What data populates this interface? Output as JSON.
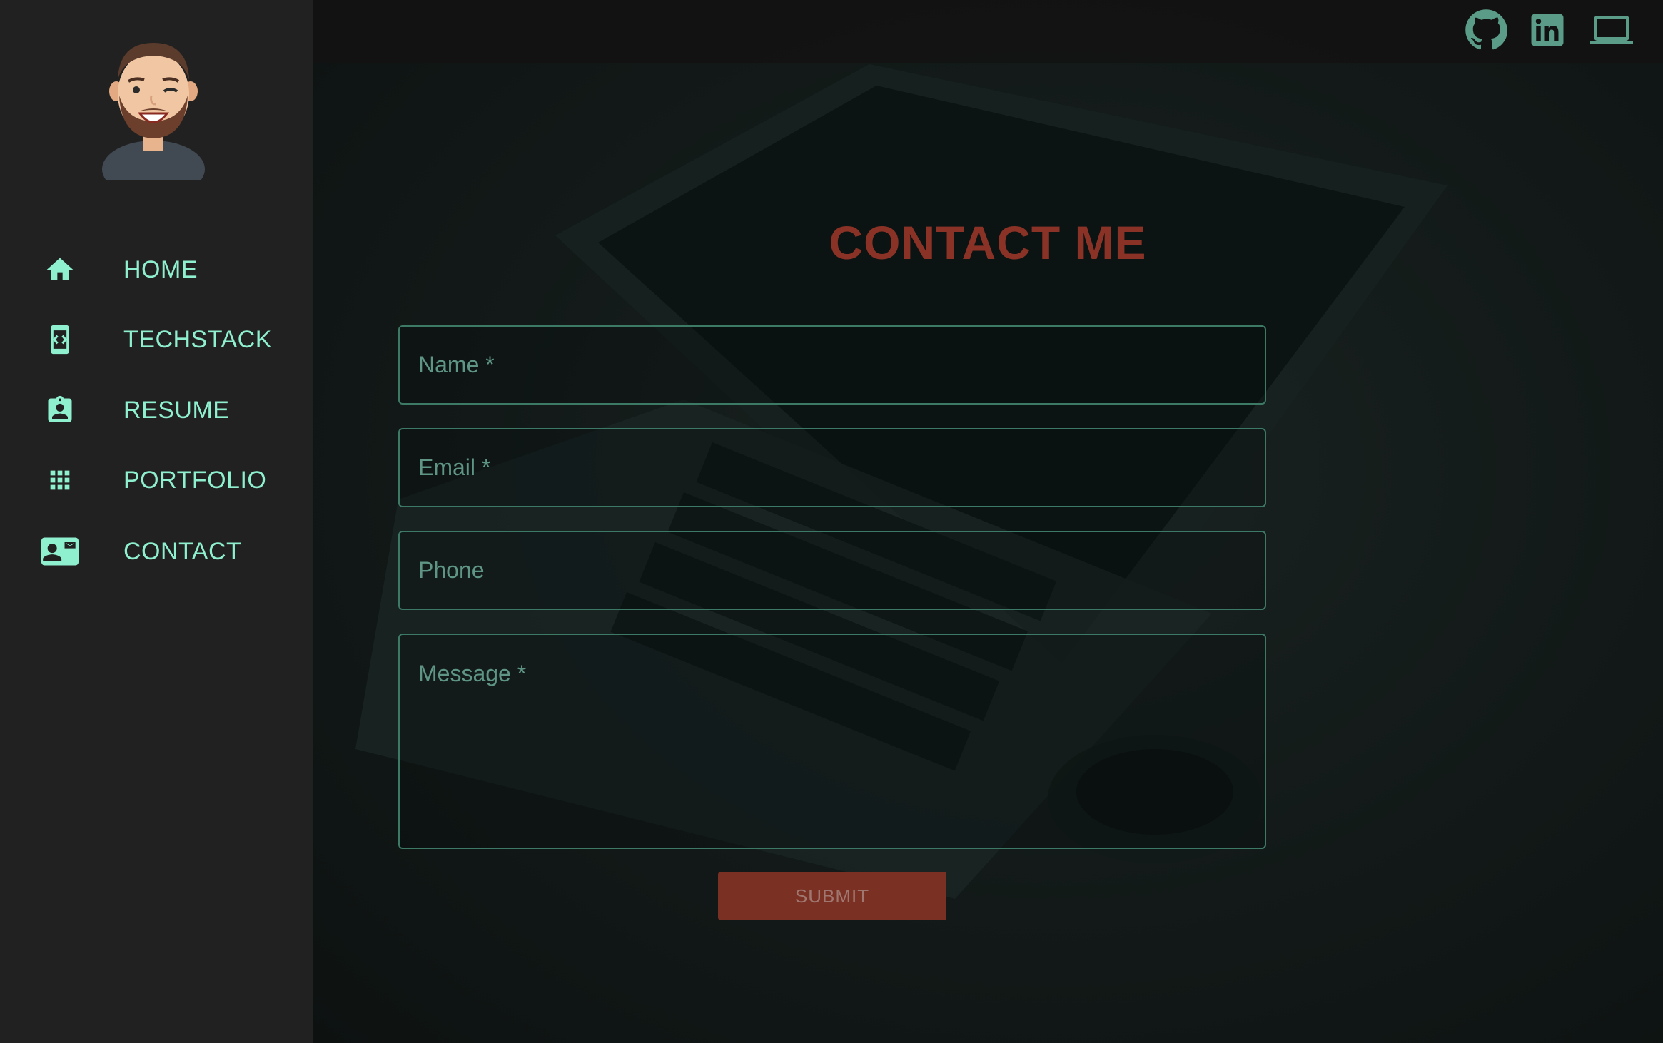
{
  "sidebar": {
    "items": [
      {
        "label": "HOME",
        "icon": "home-icon"
      },
      {
        "label": "TECHSTACK",
        "icon": "code-phone-icon"
      },
      {
        "label": "RESUME",
        "icon": "badge-icon"
      },
      {
        "label": "PORTFOLIO",
        "icon": "grid-icon"
      },
      {
        "label": "CONTACT",
        "icon": "contact-card-icon"
      }
    ]
  },
  "topbar": {
    "icons": [
      "github-icon",
      "linkedin-icon",
      "laptop-icon"
    ]
  },
  "contact": {
    "title": "CONTACT ME",
    "name_placeholder": "Name *",
    "email_placeholder": "Email *",
    "phone_placeholder": "Phone",
    "message_placeholder": "Message *",
    "submit_label": "SUBMIT"
  },
  "colors": {
    "accent": "#8ef0cf",
    "title": "#8a3226",
    "submit_bg": "#7a3124",
    "field_border": "#3d7a66",
    "sidebar_bg": "#212121"
  }
}
